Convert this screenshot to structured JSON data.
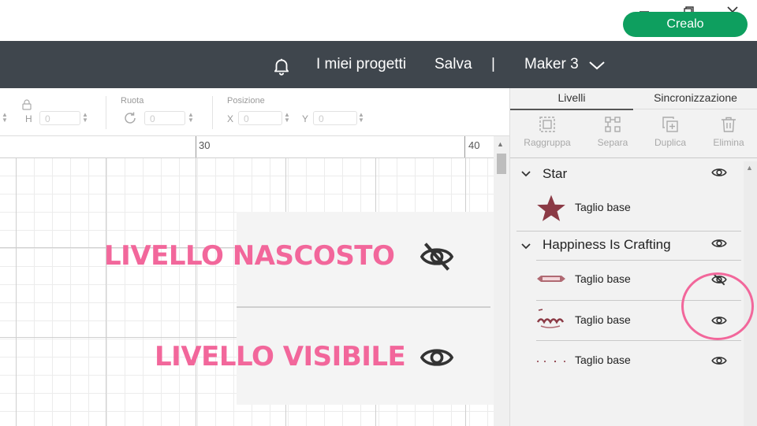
{
  "header": {
    "my_projects": "I miei progetti",
    "save": "Salva",
    "separator": "|",
    "machine": "Maker 3",
    "make_button": "Crealo"
  },
  "toolbar": {
    "size_h_label": "H",
    "size_h_value": "0",
    "rotate_label": "Ruota",
    "rotate_value": "0",
    "position_label": "Posizione",
    "pos_x_label": "X",
    "pos_x_value": "0",
    "pos_y_label": "Y",
    "pos_y_value": "0"
  },
  "ruler": {
    "mark_30": "30",
    "mark_40": "40"
  },
  "overlay": {
    "hidden_text": "LIVELLO NASCOSTO",
    "visible_text": "LIVELLO VISIBILE"
  },
  "panel": {
    "tabs": {
      "layers": "Livelli",
      "sync": "Sincronizzazione"
    },
    "actions": {
      "group": "Raggruppa",
      "ungroup": "Separa",
      "duplicate": "Duplica",
      "delete": "Elimina"
    },
    "groups": [
      {
        "title": "Star",
        "layers": [
          {
            "label": "Taglio base",
            "visible": true
          }
        ]
      },
      {
        "title": "Happiness Is Crafting",
        "layers": [
          {
            "label": "Taglio base",
            "visible": false
          },
          {
            "label": "Taglio base",
            "visible": true
          },
          {
            "label": "Taglio base",
            "visible": true
          }
        ]
      }
    ]
  },
  "colors": {
    "header_bg": "#3f464d",
    "make_button": "#0e9f5f",
    "annotation_pink": "#f2679b",
    "star": "#8b3a45"
  },
  "icons": [
    "minimize-icon",
    "restore-icon",
    "close-icon",
    "bell-icon",
    "chevron-down-icon",
    "lock-icon",
    "rotate-icon",
    "group-icon",
    "ungroup-icon",
    "duplicate-icon",
    "delete-icon",
    "eye-icon",
    "eye-slash-icon",
    "star-icon"
  ]
}
